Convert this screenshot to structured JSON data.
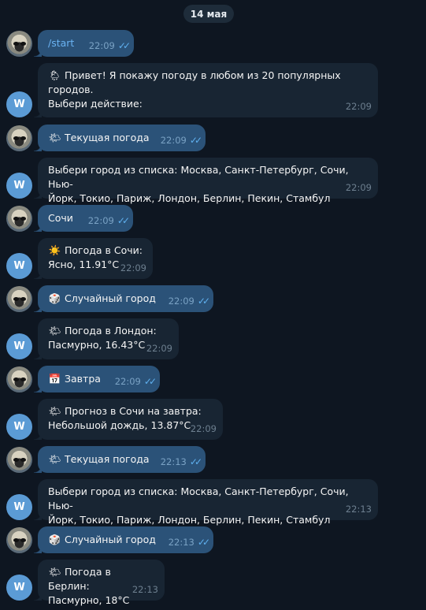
{
  "date_label": "14 мая",
  "bot_avatar_letter": "W",
  "messages": [
    {
      "from": "user",
      "text": "/start",
      "time": "22:09"
    },
    {
      "from": "bot",
      "emoji": "🌦",
      "text": "Привет! Я покажу погоду в любом из 20 популярных\nгородов.\nВыбери действие:",
      "time": "22:09"
    },
    {
      "from": "user",
      "emoji": "🌤",
      "text": "Текущая погода",
      "time": "22:09"
    },
    {
      "from": "bot",
      "text": "Выбери город из списка: Москва, Санкт-Петербург, Сочи, Нью-\nЙорк, Токио, Париж, Лондон, Берлин, Пекин, Стамбул",
      "time": "22:09"
    },
    {
      "from": "user",
      "text": "Сочи",
      "time": "22:09"
    },
    {
      "from": "bot",
      "emoji": "☀️",
      "text": "Погода в Сочи:\nЯсно, 11.91°C",
      "time": "22:09"
    },
    {
      "from": "user",
      "emoji": "🎲",
      "text": "Случайный город",
      "time": "22:09"
    },
    {
      "from": "bot",
      "emoji": "🌤",
      "text": "Погода в Лондон:\nПасмурно, 16.43°C",
      "time": "22:09"
    },
    {
      "from": "user",
      "emoji": "📅",
      "text": "Завтра",
      "time": "22:09"
    },
    {
      "from": "bot",
      "emoji": "🌤",
      "text": "Прогноз в Сочи на завтра:\nНебольшой дождь, 13.87°C",
      "time": "22:09"
    },
    {
      "from": "user",
      "emoji": "🌤",
      "text": "Текущая погода",
      "time": "22:13"
    },
    {
      "from": "bot",
      "text": "Выбери город из списка: Москва, Санкт-Петербург, Сочи, Нью-\nЙорк, Токио, Париж, Лондон, Берлин, Пекин, Стамбул",
      "time": "22:13"
    },
    {
      "from": "user",
      "emoji": "🎲",
      "text": "Случайный город",
      "time": "22:13"
    },
    {
      "from": "bot",
      "emoji": "🌤",
      "text": "Погода в Берлин:\nПасмурно, 18°C",
      "time": "22:13"
    }
  ]
}
